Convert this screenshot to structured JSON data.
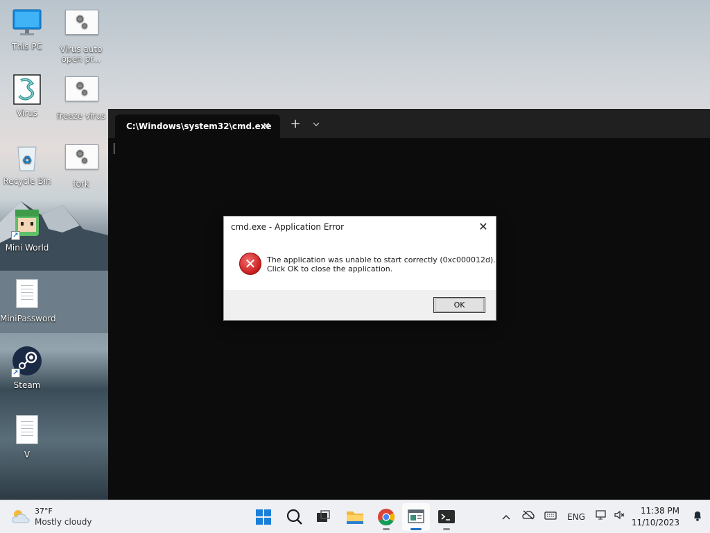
{
  "desktop": {
    "icons": [
      {
        "label": "This PC"
      },
      {
        "label": "Virus auto open pr..."
      },
      {
        "label": "Virus"
      },
      {
        "label": "freeze virus"
      },
      {
        "label": "Recycle Bin"
      },
      {
        "label": "fork"
      },
      {
        "label": "Mini World"
      },
      {
        "label": "MiniPassword"
      },
      {
        "label": "Steam"
      },
      {
        "label": "V"
      }
    ]
  },
  "terminal": {
    "tab_title": "C:\\Windows\\system32\\cmd.exe",
    "tab_close_glyph": "✕",
    "new_tab_glyph": "+",
    "dropdown_glyph": "⌄",
    "background": "#0c0c0c"
  },
  "dialog": {
    "title": "cmd.exe - Application Error",
    "close_glyph": "✕",
    "message_line1": "The application was unable to start correctly (0xc000012d).",
    "message_line2": "Click OK to close the application.",
    "icon": "error-icon",
    "ok_label": "OK"
  },
  "taskbar": {
    "weather": {
      "temp": "37°F",
      "condition": "Mostly cloudy",
      "icon": "cloud-sun-icon"
    },
    "apps": [
      {
        "name": "start-button",
        "icon": "windows-logo-icon"
      },
      {
        "name": "search-button",
        "icon": "search-icon"
      },
      {
        "name": "task-view-button",
        "icon": "task-view-icon"
      },
      {
        "name": "file-explorer-button",
        "icon": "folder-icon"
      },
      {
        "name": "chrome-button",
        "icon": "chrome-icon"
      },
      {
        "name": "active-app-button",
        "icon": "window-app-icon"
      },
      {
        "name": "terminal-button",
        "icon": "terminal-icon"
      }
    ],
    "tray": {
      "language": "ENG",
      "time": "11:38 PM",
      "date": "11/10/2023"
    }
  }
}
